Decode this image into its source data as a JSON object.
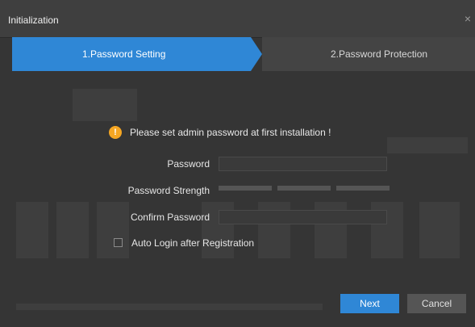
{
  "window": {
    "title": "Initialization",
    "close_glyph": "×"
  },
  "steps": [
    {
      "label": "1.Password Setting",
      "active": true
    },
    {
      "label": "2.Password Protection",
      "active": false
    }
  ],
  "notice": {
    "icon": "warning-icon",
    "glyph": "!",
    "text": "Please set admin password at first installation !"
  },
  "form": {
    "password_label": "Password",
    "strength_label": "Password Strength",
    "confirm_label": "Confirm Password",
    "password_value": "",
    "confirm_value": ""
  },
  "options": {
    "auto_login_label": "Auto Login after Registration",
    "auto_login_checked": false
  },
  "buttons": {
    "next": "Next",
    "cancel": "Cancel"
  },
  "colors": {
    "accent": "#2f87d6",
    "warning": "#f5a623",
    "background": "#353535"
  }
}
